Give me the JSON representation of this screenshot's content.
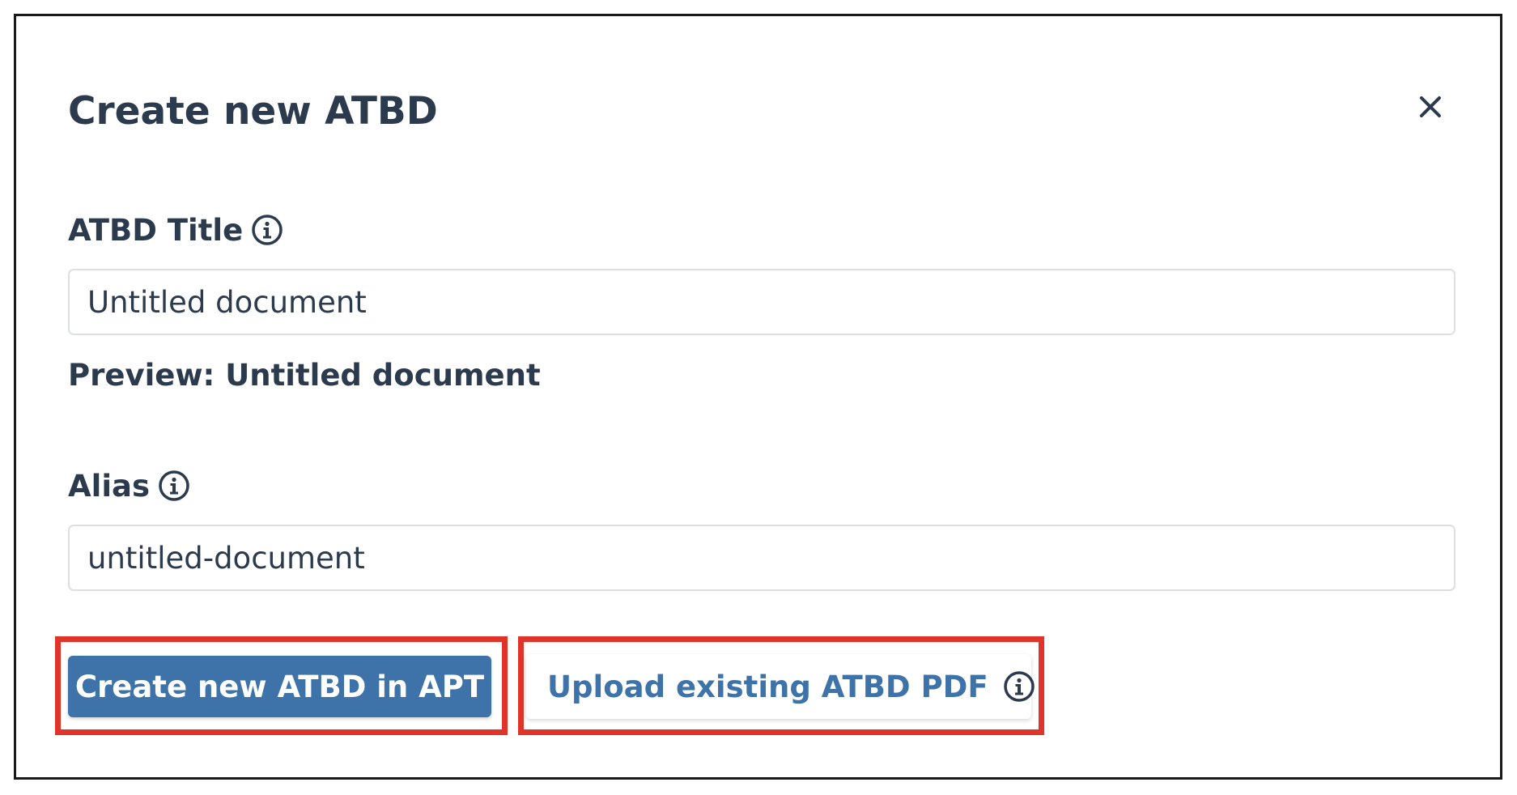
{
  "modal": {
    "title": "Create new ATBD",
    "close_icon": "close-icon"
  },
  "fields": {
    "title": {
      "label": "ATBD Title",
      "value": "Untitled document",
      "info_icon": "info-icon"
    },
    "preview": "Preview: Untitled document",
    "alias": {
      "label": "Alias",
      "value": "untitled-document",
      "info_icon": "info-icon"
    }
  },
  "actions": {
    "create_label": "Create new ATBD in APT",
    "upload_label": "Upload existing ATBD PDF",
    "upload_info_icon": "info-icon"
  },
  "colors": {
    "primary": "#3d73a8",
    "text": "#2c3a4d",
    "highlight": "#e0342a",
    "input_border": "#dcdfe3"
  }
}
